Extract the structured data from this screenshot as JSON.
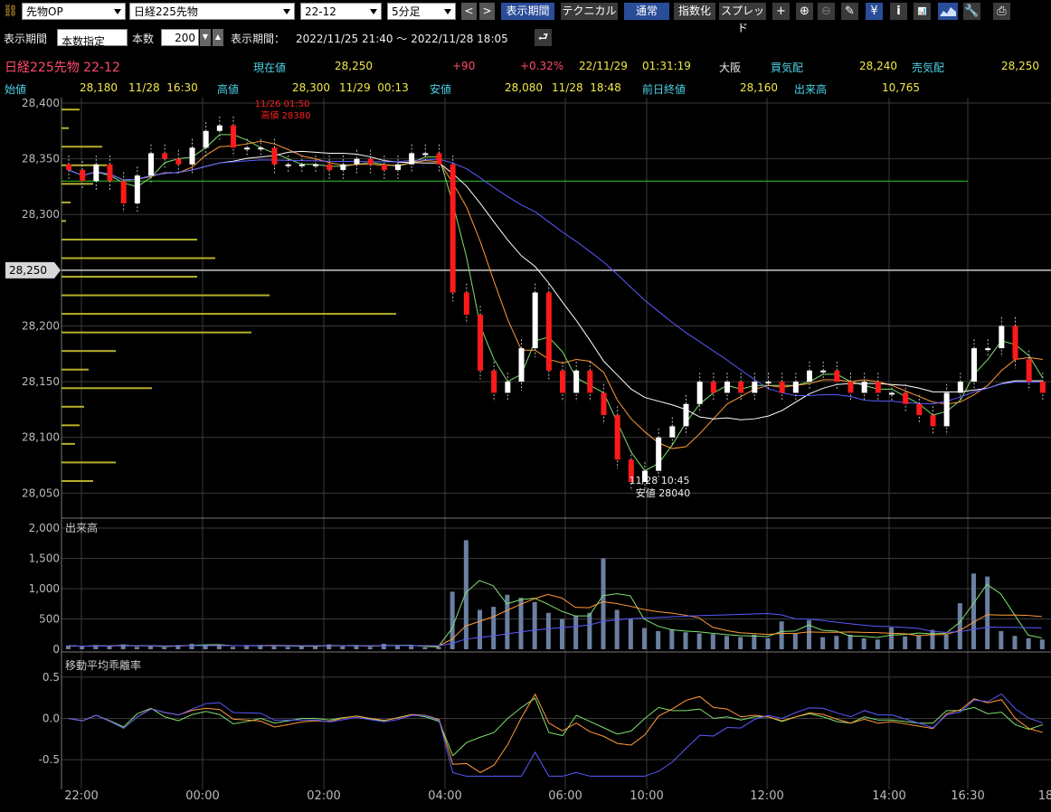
{
  "toolbar": {
    "link_icon": "link-icon",
    "market_select": "先物OP",
    "symbol_select": "日経225先物",
    "contract_select": "22-12",
    "interval_select": "5分足",
    "prev_label": "<",
    "next_label": ">",
    "period_button": "表示期間",
    "technical_button": "テクニカル",
    "normal_button": "通常",
    "index_button": "指数化",
    "spread_button": "スプレッド",
    "icons": [
      "crosshair-icon",
      "zoom-in-icon",
      "zoom-out-icon",
      "pencil-icon",
      "yen-icon",
      "info-icon",
      "my-indicator-icon",
      "mountain-chart-icon",
      "settings-wrench-icon",
      "print-icon"
    ],
    "yen_glyph": "¥",
    "info_glyph": "i"
  },
  "period_row": {
    "label1": "表示期間",
    "mode_select": "本数指定",
    "count_label": "本数",
    "count_value": "200",
    "label2": "表示期間：",
    "range_text": "2022/11/25 21:40 〜 2022/11/28 18:05"
  },
  "quote": {
    "name": "日経225先物 22-12",
    "current_label": "現在値",
    "current_value": "28,250",
    "change": "+90",
    "change_pct": "+0.32%",
    "date": "22/11/29",
    "time": "01:31:19",
    "market": "大阪",
    "bid_label": "買気配",
    "bid_value": "28,240",
    "ask_label": "売気配",
    "ask_value": "28,250",
    "open_label": "始値",
    "open_value": "28,180",
    "open_time": "11/28  16:30",
    "high_label": "高値",
    "high_value": "28,300",
    "high_time": "11/29  00:13",
    "low_label": "安値",
    "low_value": "28,080",
    "low_time": "11/28  18:48",
    "prev_close_label": "前日終値",
    "prev_close_value": "28,160",
    "volume_label": "出来高",
    "volume_value": "10,765"
  },
  "chart_data": [
    {
      "type": "candlestick",
      "title": "日経225先物 22-12",
      "ylim": [
        28030,
        28400
      ],
      "y_ticks": [
        "28,400",
        "28,350",
        "28,300",
        "28,250",
        "28,200",
        "28,150",
        "28,100",
        "28,050"
      ],
      "x_ticks": [
        "22:00",
        "00:00",
        "02:00",
        "04:00",
        "06:00",
        "10:00",
        "12:00",
        "14:00",
        "16:30",
        "18"
      ],
      "current_price_label": "28,250",
      "current_price": 28250,
      "green_line_level": 28330,
      "high_annotation": {
        "time": "11/26 01:50",
        "label": "高値 28380"
      },
      "low_annotation": {
        "time": "11/28 10:45",
        "label": "安値 28040"
      },
      "closes": [
        28340,
        28330,
        28345,
        28330,
        28310,
        28335,
        28355,
        28350,
        28345,
        28360,
        28375,
        28380,
        28360,
        28360,
        28360,
        28345,
        28345,
        28345,
        28345,
        28340,
        28345,
        28350,
        28345,
        28340,
        28345,
        28355,
        28355,
        28345,
        28230,
        28210,
        28160,
        28140,
        28150,
        28180,
        28230,
        28160,
        28140,
        28160,
        28140,
        28120,
        28080,
        28060,
        28070,
        28100,
        28110,
        28130,
        28150,
        28140,
        28150,
        28140,
        28150,
        28150,
        28140,
        28150,
        28160,
        28160,
        28150,
        28140,
        28150,
        28140,
        28140,
        28130,
        28120,
        28110,
        28140,
        28150,
        28180,
        28180,
        28200,
        28170,
        28150,
        28140
      ],
      "volume_profile": [
        20,
        8,
        45,
        50,
        35,
        10,
        5,
        150,
        170,
        150,
        230,
        370,
        210,
        60,
        30,
        100,
        25,
        20,
        15,
        60,
        35
      ]
    },
    {
      "type": "bar",
      "title": "出来高",
      "ylim": [
        0,
        2000
      ],
      "y_ticks": [
        "2,000",
        "1,500",
        "1,000",
        "500",
        "0"
      ],
      "values": [
        60,
        40,
        70,
        50,
        80,
        40,
        60,
        30,
        70,
        90,
        60,
        80,
        40,
        60,
        70,
        50,
        40,
        60,
        50,
        80,
        50,
        60,
        40,
        90,
        60,
        50,
        30,
        40,
        950,
        1800,
        650,
        700,
        900,
        850,
        780,
        600,
        500,
        550,
        600,
        1500,
        650,
        500,
        350,
        300,
        320,
        280,
        260,
        250,
        220,
        200,
        240,
        180,
        460,
        260,
        480,
        200,
        220,
        240,
        180,
        160,
        360,
        210,
        230,
        320,
        240,
        760,
        1250,
        1200,
        300,
        220,
        180,
        160
      ]
    },
    {
      "type": "line",
      "title": "移動平均乖離率",
      "ylim": [
        -0.75,
        0.75
      ],
      "y_ticks": [
        "0.5",
        "0.0",
        "-0.5"
      ]
    }
  ],
  "colors": {
    "up_candle": "#ffffff",
    "down_candle": "#ff1a1a",
    "ma_short": "#7fe070",
    "ma_mid": "#ff9a3a",
    "ma_long": "#ffffff",
    "ma_longest": "#5a5aff",
    "volume_bar": "#6b7fa0",
    "profile_bar": "#b5b02a",
    "grid": "#3a3a3a"
  }
}
